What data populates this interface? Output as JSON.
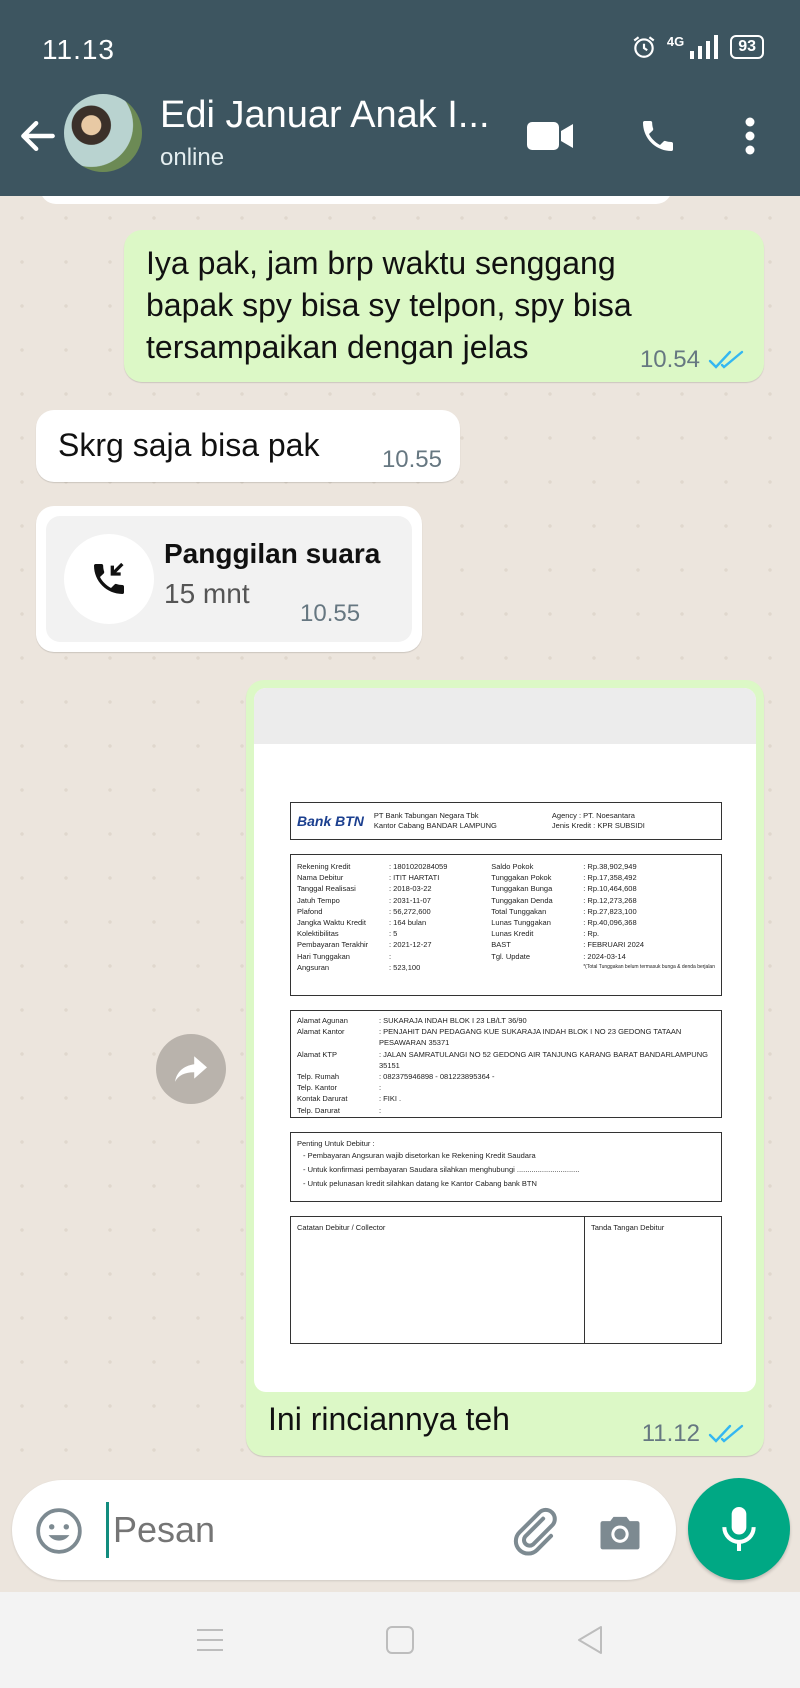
{
  "status_bar": {
    "time": "11.13",
    "network": "4G",
    "battery": "93"
  },
  "header": {
    "contact_name": "Edi Januar Anak I...",
    "status": "online"
  },
  "messages": [
    {
      "text": "Iya pak, jam brp waktu senggang bapak spy bisa sy telpon, spy bisa tersampaikan dengan jelas",
      "time": "10.54"
    },
    {
      "text": "Skrg saja bisa pak",
      "time": "10.55"
    },
    {
      "call_title": "Panggilan suara",
      "duration": "15 mnt",
      "time": "10.55"
    },
    {
      "caption": "Ini rinciannya teh",
      "time": "11.12"
    }
  ],
  "document": {
    "bank_logo": "Bank BTN",
    "bank_name": "PT Bank Tabungan Negara Tbk",
    "branch": "Kantor Cabang BANDAR LAMPUNG",
    "agency": "Agency      : PT. Noesantara",
    "jenis_kredit": "Jenis Kredit : KPR SUBSIDI",
    "left_rows": [
      {
        "k": "Rekening Kredit",
        "v": ": 1801020284059"
      },
      {
        "k": "Nama Debitur",
        "v": ": ITIT HARTATI"
      },
      {
        "k": "Tanggal Realisasi",
        "v": ": 2018-03-22"
      },
      {
        "k": "Jatuh Tempo",
        "v": ": 2031-11-07"
      },
      {
        "k": "Plafond",
        "v": ": 56,272,600"
      },
      {
        "k": "Jangka Waktu Kredit",
        "v": ": 164 bulan"
      },
      {
        "k": "Kolektibilitas",
        "v": ": 5"
      },
      {
        "k": "Pembayaran Terakhir",
        "v": ": 2021-12-27"
      },
      {
        "k": "Hari Tunggakan",
        "v": ":"
      },
      {
        "k": "Angsuran",
        "v": ": 523,100"
      }
    ],
    "right_rows": [
      {
        "k": "Saldo Pokok",
        "v": ": Rp.38,902,949"
      },
      {
        "k": "Tunggakan Pokok",
        "v": ": Rp.17,358,492"
      },
      {
        "k": "Tunggakan Bunga",
        "v": ": Rp.10,464,608"
      },
      {
        "k": "Tunggakan Denda",
        "v": ": Rp.12,273,268"
      },
      {
        "k": "Total Tunggakan",
        "v": ": Rp.27,823,100"
      },
      {
        "k": "Lunas Tunggakan",
        "v": ": Rp.40,096,368"
      },
      {
        "k": "Lunas Kredit",
        "v": ": Rp."
      },
      {
        "k": "BAST",
        "v": ": FEBRUARI 2024"
      },
      {
        "k": "Tgl. Update",
        "v": ": 2024-03-14"
      },
      {
        "k": "",
        "v": "*(Total Tunggakan belum termasuk bunga & denda berjalan"
      }
    ],
    "address_rows": [
      {
        "k": "Alamat Agunan",
        "v": ": SUKARAJA INDAH BLOK I 23 LB/LT 36/90"
      },
      {
        "k": "Alamat Kantor",
        "v": ": PENJAHIT DAN PEDAGANG KUE SUKARAJA INDAH BLOK I NO 23 GEDONG TATAAN PESAWARAN 35371"
      },
      {
        "k": "Alamat KTP",
        "v": ": JALAN SAMRATULANGI NO 52 GEDONG AIR TANJUNG KARANG BARAT BANDARLAMPUNG 35151"
      },
      {
        "k": "Telp. Rumah",
        "v": ": 082375946898 - 081223895364 -"
      },
      {
        "k": "Telp. Kantor",
        "v": ":"
      },
      {
        "k": "Kontak Darurat",
        "v": ": FIKI ."
      },
      {
        "k": "Telp. Darurat",
        "v": ":"
      }
    ],
    "notes_title": "Penting Untuk Debitur :",
    "notes": [
      "- Pembayaran Angsuran wajib disetorkan ke Rekening Kredit Saudara",
      "- Untuk konfirmasi pembayaran Saudara silahkan menghubungi ..............................",
      "- Untuk pelunasan kredit silahkan datang ke Kantor Cabang bank BTN"
    ],
    "catatan_label": "Catatan Debitur / Collector",
    "tanda_tangan_label": "Tanda Tangan Debitur"
  },
  "input": {
    "placeholder": "Pesan"
  },
  "colors": {
    "header": "#3d5560",
    "outgoing": "#dcf8c6",
    "accent": "#00a884",
    "read_ticks": "#34b7f1"
  }
}
